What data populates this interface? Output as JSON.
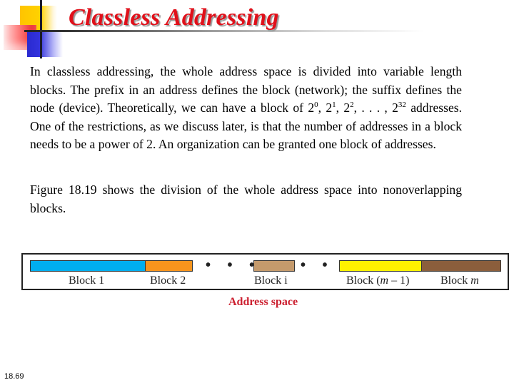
{
  "slide": {
    "title": "Classless Addressing",
    "page_number": "18.69"
  },
  "paragraph1": {
    "part1": "In classless addressing, the whole address space is divided into variable length blocks. The prefix in an address defines the block (network); the suffix defines the node (device). Theoretically, we can have a block of 2",
    "sup0": "0",
    "part2": ", 2",
    "sup1": "1",
    "part3": ", 2",
    "sup2": "2",
    "part4": ", . . . , 2",
    "sup32": "32",
    "part5": " addresses. One of the restrictions, as we discuss later, is that the number of addresses in a block needs to be a power of 2. An organization can be granted one block of addresses."
  },
  "paragraph2": "Figure 18.19 shows the division of the whole address space into nonoverlapping blocks.",
  "figure": {
    "caption": "Address space",
    "ellipsis": "• • •",
    "blocks": [
      {
        "label_prefix": "Block 1",
        "label_var": "",
        "label_suffix": "",
        "color": "#00aeef"
      },
      {
        "label_prefix": "Block 2",
        "label_var": "",
        "label_suffix": "",
        "color": "#f7941d"
      },
      {
        "label_prefix": "Block i",
        "label_var": "",
        "label_suffix": "",
        "color": "#c49a6c"
      },
      {
        "label_prefix": "Block (",
        "label_var": "m",
        "label_suffix": " – 1)",
        "color": "#fff200"
      },
      {
        "label_prefix": "Block ",
        "label_var": "m",
        "label_suffix": "",
        "color": "#8b5e3c"
      }
    ]
  }
}
